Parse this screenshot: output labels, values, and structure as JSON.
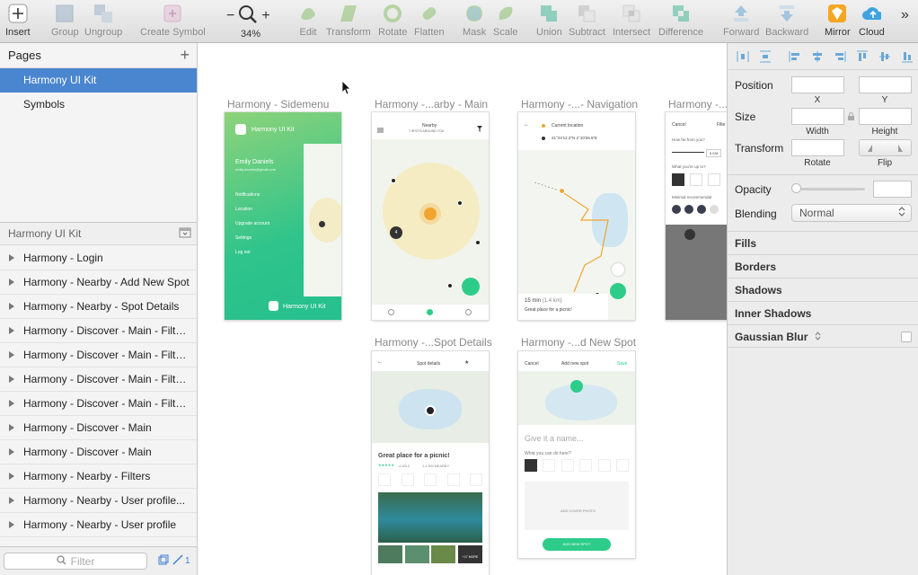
{
  "toolbar": {
    "insert": "Insert",
    "group": "Group",
    "ungroup": "Ungroup",
    "create_symbol": "Create Symbol",
    "zoom_minus": "−",
    "zoom_plus": "+",
    "zoom": "34%",
    "edit": "Edit",
    "transform": "Transform",
    "rotate": "Rotate",
    "flatten": "Flatten",
    "mask": "Mask",
    "scale": "Scale",
    "union": "Union",
    "subtract": "Subtract",
    "intersect": "Intersect",
    "difference": "Difference",
    "forward": "Forward",
    "backward": "Backward",
    "mirror": "Mirror",
    "cloud": "Cloud",
    "more": "»"
  },
  "sidebar": {
    "pages_title": "Pages",
    "add": "+",
    "pages": [
      "Harmony UI Kit",
      "Symbols"
    ],
    "layers_title": "Harmony UI Kit",
    "layers": [
      "Harmony - Login",
      "Harmony - Nearby - Add New Spot",
      "Harmony - Nearby - Spot Details",
      "Harmony - Discover - Main - Filte...",
      "Harmony - Discover - Main - Filte...",
      "Harmony - Discover - Main - Filte...",
      "Harmony - Discover - Main - Filte...",
      "Harmony - Discover - Main",
      "Harmony - Discover - Main",
      "Harmony - Nearby - Filters",
      "Harmony - Nearby - User profile...",
      "Harmony - Nearby - User profile"
    ],
    "filter_placeholder": "Filter",
    "count": "1"
  },
  "canvas": {
    "artboards": [
      {
        "title": "Harmony - Sidemenu"
      },
      {
        "title": "Harmony -...arby - Main"
      },
      {
        "title": "Harmony -...- Navigation"
      },
      {
        "title": "Harmony -..."
      },
      {
        "title": "Harmony -...Spot Details"
      },
      {
        "title": "Harmony -...d New Spot"
      }
    ],
    "sidemenu": {
      "brand": "Harmony UI Kit",
      "user_name": "Emily Daniels",
      "user_email": "emily.daniels@gmail.com",
      "items": [
        "Notifications",
        "Location",
        "Upgrade account",
        "Settings",
        "Log out"
      ],
      "footer": "Harmony UI Kit"
    },
    "nearby": {
      "title": "Nearby",
      "subtitle": "7 SPOTS AROUND YOU",
      "marker_a": "4",
      "marker_b": "4"
    },
    "navigation": {
      "current": "Current location",
      "coords": "41°24'12.2\"N 2°10'26.5\"E",
      "eta": "15 min",
      "distance": "(1.4 km)",
      "place": "Great place for a picnic!"
    },
    "filters": {
      "cancel": "Cancel",
      "title": "Filte",
      "q1": "How far from you?",
      "km": "5 KM",
      "q2": "What you're up to?",
      "q3": "Minimal recommendat"
    },
    "details": {
      "title": "Spot details",
      "name": "Great place for a picnic!",
      "rating": "4.9/5.0",
      "distance": "1.4 KM NEARBY",
      "more": "+17 MORE"
    },
    "addspot": {
      "cancel": "Cancel",
      "title": "Add new spot",
      "save": "Save",
      "placeholder": "Give it a name...",
      "question": "What you can do here?",
      "cover": "ADD COVER PHOTO",
      "cta": "ADD NEW SPOT"
    }
  },
  "inspector": {
    "position": "Position",
    "x": "X",
    "y": "Y",
    "size": "Size",
    "width": "Width",
    "height": "Height",
    "transform": "Transform",
    "rotate": "Rotate",
    "flip": "Flip",
    "opacity": "Opacity",
    "blending": "Blending",
    "blending_value": "Normal",
    "sections": [
      "Fills",
      "Borders",
      "Shadows",
      "Inner Shadows",
      "Gaussian Blur"
    ]
  },
  "colors": {
    "selection": "#4a86cf",
    "green": "#2ecc8a",
    "orange": "#f0a52e"
  }
}
